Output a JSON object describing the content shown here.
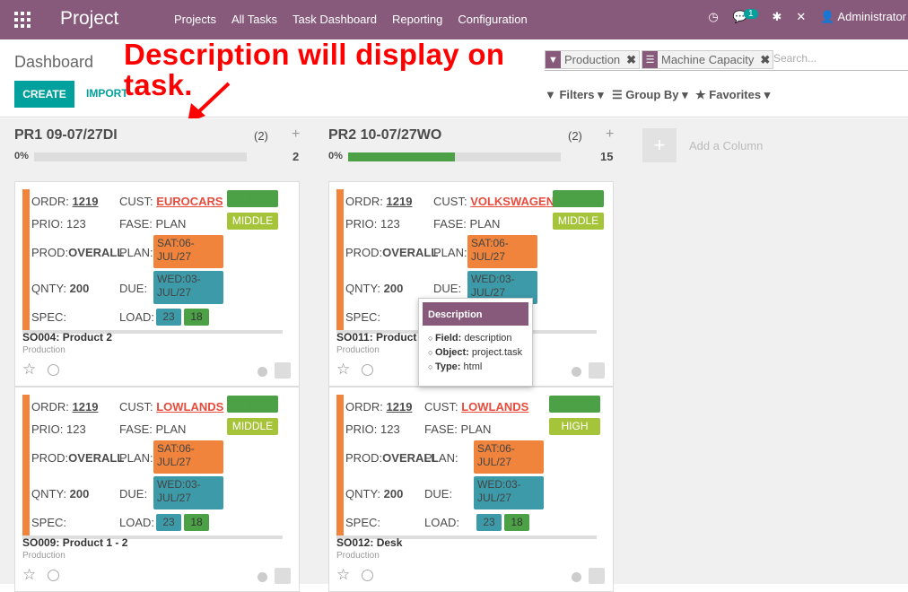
{
  "topbar": {
    "brand": "Project",
    "menu": [
      "Projects",
      "All Tasks",
      "Task Dashboard",
      "Reporting",
      "Configuration"
    ],
    "chat_badge": "1",
    "user": "Administrator"
  },
  "control": {
    "breadcrumb": "Dashboard",
    "create": "CREATE",
    "import": "IMPORT",
    "annotation": "Description will display on task.",
    "facets": [
      "Production",
      "Machine Capacity"
    ],
    "search_placeholder": "Search...",
    "filters": "Filters",
    "group_by": "Group By",
    "favorites": "Favorites"
  },
  "columns": [
    {
      "title": "PR1 09-07/27DI",
      "count": "(2)",
      "pct": "0%",
      "total": "2",
      "progress": 0
    },
    {
      "title": "PR2 10-07/27WO",
      "count": "(2)",
      "pct": "0%",
      "total": "15",
      "progress": 0.5
    }
  ],
  "add_column": "Add a Column",
  "labels": {
    "ordr": "ORDR:",
    "cust": "CUST:",
    "prio": "PRIO:",
    "fase": "FASE:",
    "prod": "PROD:",
    "plan": "PLAN:",
    "qnty": "QNTY:",
    "due": "DUE:",
    "spec": "SPEC:",
    "load": "LOAD:"
  },
  "cards": [
    {
      "ordr": "1219",
      "cust": "EUROCARS",
      "stage": "PROD",
      "prio": "123",
      "fase": "PLAN",
      "level": "MIDDLE",
      "prod": "OVERALL",
      "plan": "SAT:06-JUL/27",
      "qnty": "200",
      "due": "WED:03-JUL/27",
      "load1": "23",
      "load2": "18",
      "title": "SO004: Product 2",
      "project": "Production"
    },
    {
      "ordr": "1219",
      "cust": "LOWLANDS",
      "stage": "PROD",
      "prio": "123",
      "fase": "PLAN",
      "level": "MIDDLE",
      "prod": "OVERALL",
      "plan": "SAT:06-JUL/27",
      "qnty": "200",
      "due": "WED:03-JUL/27",
      "load1": "23",
      "load2": "18",
      "title": "SO009: Product 1 - 2",
      "project": "Production"
    },
    {
      "ordr": "1219",
      "cust": "VOLKSWAGEN",
      "stage": "PROD",
      "prio": "123",
      "fase": "PLAN",
      "level": "MIDDLE",
      "prod": "OVERALL",
      "plan": "SAT:06-JUL/27",
      "qnty": "200",
      "due": "WED:03-JUL/27",
      "load1": "23",
      "load2": "18",
      "title": "SO011: Product",
      "project": "Production"
    },
    {
      "ordr": "1219",
      "cust": "LOWLANDS",
      "stage": "PROD",
      "prio": "123",
      "fase": "PLAN",
      "level": "HIGH",
      "prod": "OVERALL",
      "plan": "SAT:06-JUL/27",
      "qnty": "200",
      "due": "WED:03-JUL/27",
      "load1": "23",
      "load2": "18",
      "title": "SO012: Desk",
      "project": "Production"
    }
  ],
  "tooltip": {
    "title": "Description",
    "field_label": "Field:",
    "field": "description",
    "object_label": "Object:",
    "object": "project.task",
    "type_label": "Type:",
    "type": "html"
  }
}
